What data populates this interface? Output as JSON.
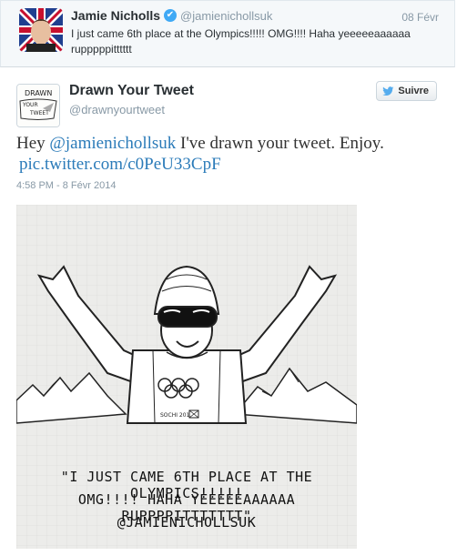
{
  "quoted": {
    "name": "Jamie Nicholls",
    "handle": "@jamienichollsuk",
    "date": "08 Févr",
    "text": "I just came 6th place at the Olympics!!!!! OMG!!!! Haha yeeeeeaaaaaa rupppppitttttt"
  },
  "tweet": {
    "name": "Drawn Your Tweet",
    "handle": "@drawnyourtweet",
    "follow_label": "Suivre",
    "text_before": "Hey ",
    "mention": "@jamienichollsuk",
    "text_after": " I've drawn your tweet. Enjoy.",
    "pic_link": "pic.twitter.com/c0PeU33CpF",
    "timestamp": "4:58 PM - 8 Févr 2014",
    "avatar_text_1": "DRAWN",
    "avatar_text_2": "YOUR",
    "avatar_text_3": "TWEET"
  },
  "image": {
    "line1": "\"I JUST CAME 6TH PLACE AT THE OLYMPICS!!!!!",
    "line2": "OMG!!!! HAHA YEEEEEAAAAAA RUPPPPITTTTTTT\"",
    "line3": "@JAMIENICHOLLSUK",
    "sochi_label": "SOCHI 2014"
  },
  "colors": {
    "link": "#2b7bb9",
    "verified": "#3fa9f5",
    "muted": "#8899a6"
  }
}
